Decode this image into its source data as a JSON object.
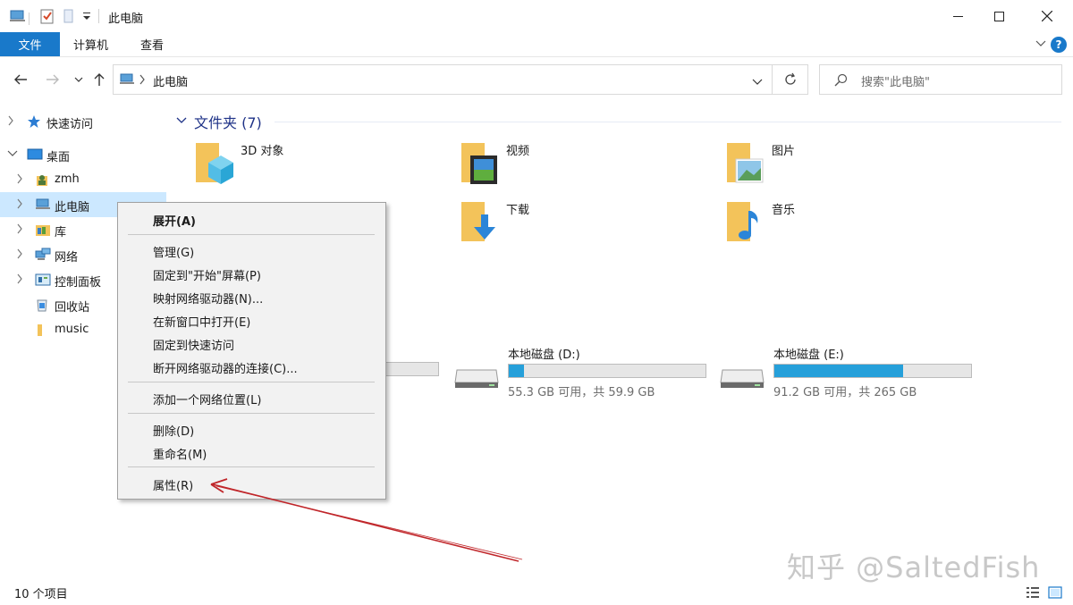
{
  "window": {
    "title": "此电脑"
  },
  "ribbon": {
    "tabs": [
      "文件",
      "计算机",
      "查看"
    ],
    "help_label": "?"
  },
  "address": {
    "path": "此电脑",
    "search_placeholder": "搜索\"此电脑\""
  },
  "sidebar": {
    "items": [
      {
        "label": "快速访问",
        "icon": "star-icon"
      },
      {
        "label": "桌面",
        "icon": "desktop-icon"
      },
      {
        "label": "zmh",
        "icon": "user-folder-icon"
      },
      {
        "label": "此电脑",
        "icon": "computer-icon"
      },
      {
        "label": "库",
        "icon": "library-icon"
      },
      {
        "label": "网络",
        "icon": "network-icon"
      },
      {
        "label": "控制面板",
        "icon": "control-panel-icon"
      },
      {
        "label": "回收站",
        "icon": "recycle-bin-icon"
      },
      {
        "label": "music",
        "icon": "folder-icon"
      }
    ]
  },
  "content": {
    "folders_group": "文件夹 (7)",
    "folders": [
      {
        "name": "3D 对象",
        "icon": "3d-objects-icon"
      },
      {
        "name": "视频",
        "icon": "videos-folder-icon"
      },
      {
        "name": "图片",
        "icon": "pictures-folder-icon"
      },
      {
        "name": "下载",
        "icon": "downloads-folder-icon"
      },
      {
        "name": "音乐",
        "icon": "music-folder-icon"
      }
    ],
    "drives": [
      {
        "name": "本地磁盘 (D:)",
        "free_text": "55.3 GB 可用，共 59.9 GB",
        "used_fraction": 0.077
      },
      {
        "name": "本地磁盘 (E:)",
        "free_text": "91.2 GB 可用，共 265 GB",
        "used_fraction": 0.656
      }
    ]
  },
  "context_menu": {
    "items": [
      "展开(A)",
      "管理(G)",
      "固定到\"开始\"屏幕(P)",
      "映射网络驱动器(N)...",
      "在新窗口中打开(E)",
      "固定到快速访问",
      "断开网络驱动器的连接(C)...",
      "添加一个网络位置(L)",
      "删除(D)",
      "重命名(M)",
      "属性(R)"
    ]
  },
  "status": {
    "count": "10 个项目"
  },
  "watermark": "知乎 @SaltedFish",
  "colors": {
    "accent": "#1979ca",
    "selection": "#cce8ff",
    "drive_fill": "#26a0da",
    "annotation_arrow": "#c0262a"
  }
}
